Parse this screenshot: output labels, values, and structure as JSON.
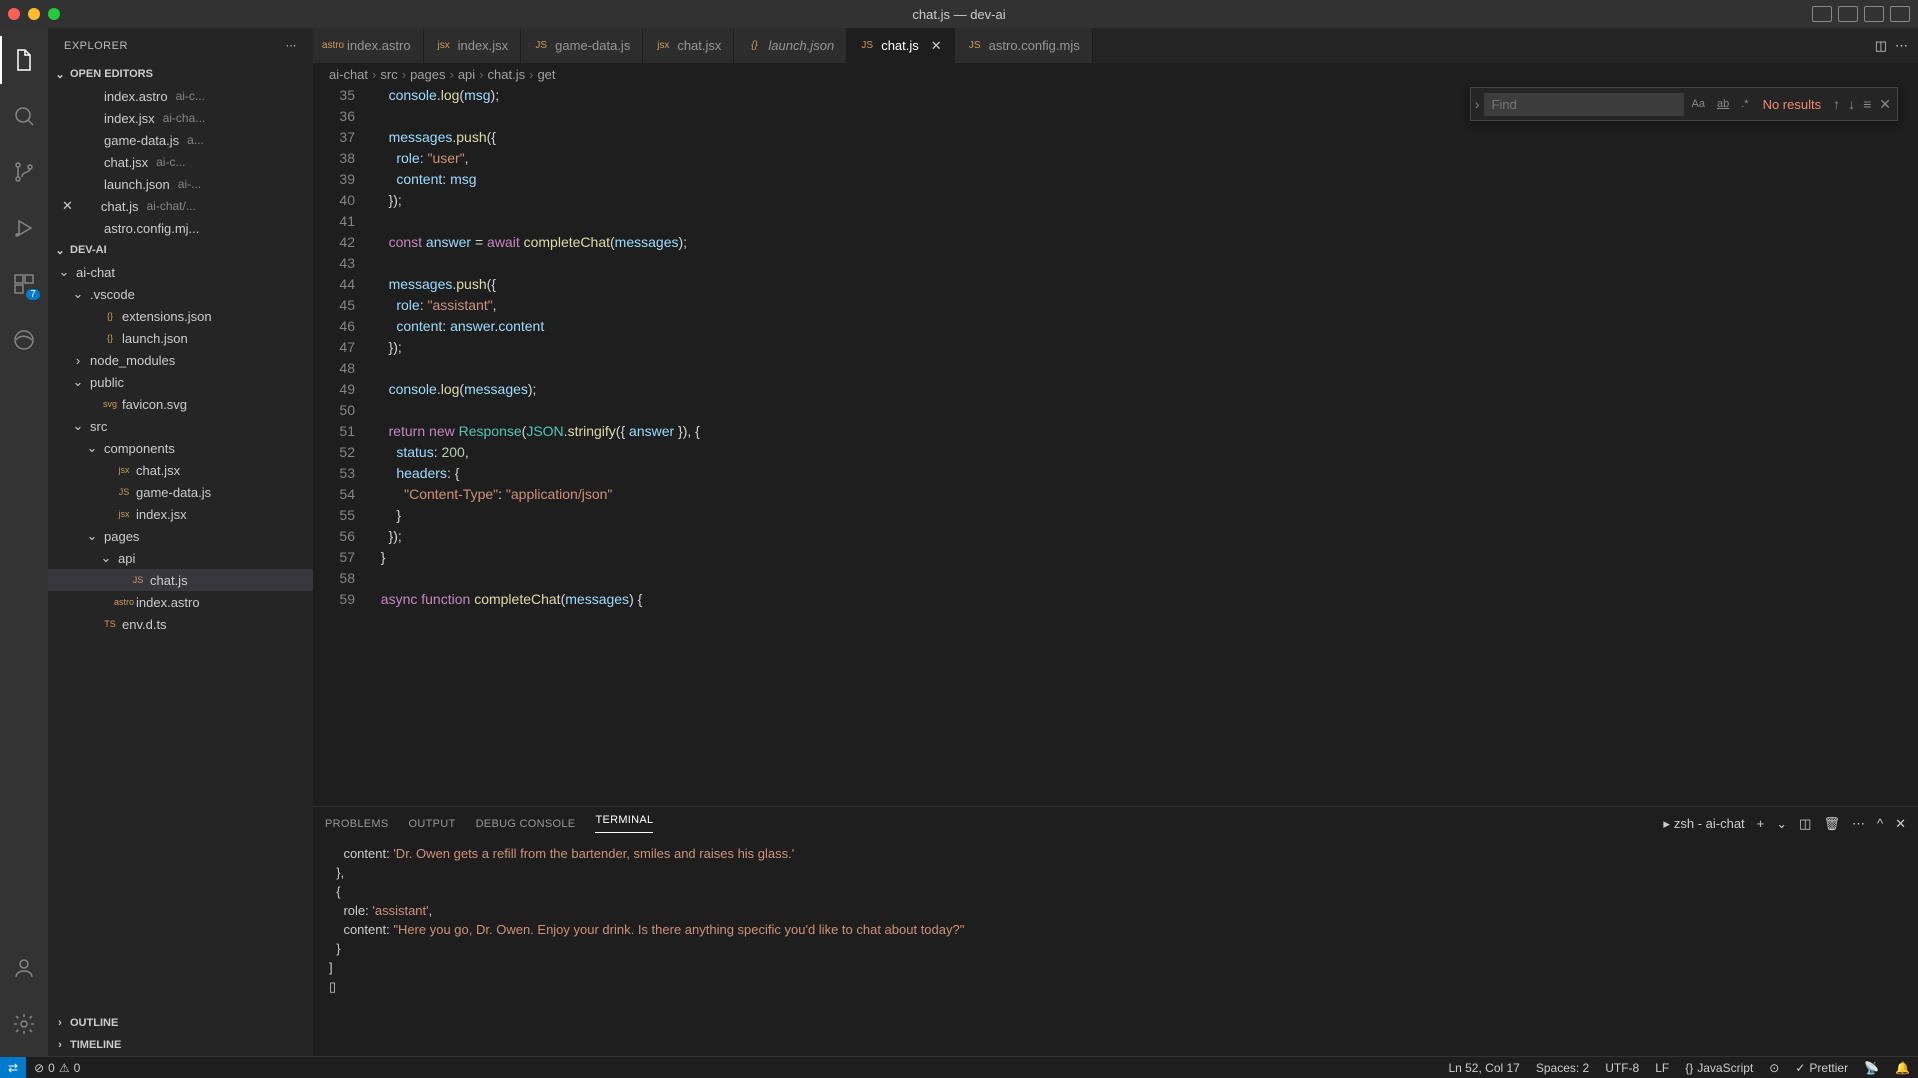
{
  "window": {
    "title": "chat.js — dev-ai"
  },
  "explorer": {
    "title": "EXPLORER"
  },
  "sections": {
    "open_editors": "OPEN EDITORS",
    "workspace": "DEV-AI",
    "outline": "OUTLINE",
    "timeline": "TIMELINE"
  },
  "open_editors": [
    {
      "name": "index.astro",
      "hint": "ai-c..."
    },
    {
      "name": "index.jsx",
      "hint": "ai-cha..."
    },
    {
      "name": "game-data.js",
      "hint": "a..."
    },
    {
      "name": "chat.jsx",
      "hint": "ai-c..."
    },
    {
      "name": "launch.json",
      "hint": "ai-..."
    },
    {
      "name": "chat.js",
      "hint": "ai-chat/...",
      "close": true
    },
    {
      "name": "astro.config.mj...",
      "hint": ""
    }
  ],
  "tree": {
    "root": "ai-chat",
    "folders_files": [
      {
        "type": "folder",
        "name": ".vscode",
        "depth": 1,
        "open": true
      },
      {
        "type": "file",
        "name": "extensions.json",
        "depth": 2,
        "icon": "{}"
      },
      {
        "type": "file",
        "name": "launch.json",
        "depth": 2,
        "icon": "{}"
      },
      {
        "type": "folder",
        "name": "node_modules",
        "depth": 1,
        "open": false
      },
      {
        "type": "folder",
        "name": "public",
        "depth": 1,
        "open": true
      },
      {
        "type": "file",
        "name": "favicon.svg",
        "depth": 2,
        "icon": "svg"
      },
      {
        "type": "folder",
        "name": "src",
        "depth": 1,
        "open": true
      },
      {
        "type": "folder",
        "name": "components",
        "depth": 2,
        "open": true
      },
      {
        "type": "file",
        "name": "chat.jsx",
        "depth": 3,
        "icon": "jsx"
      },
      {
        "type": "file",
        "name": "game-data.js",
        "depth": 3,
        "icon": "JS"
      },
      {
        "type": "file",
        "name": "index.jsx",
        "depth": 3,
        "icon": "jsx"
      },
      {
        "type": "folder",
        "name": "pages",
        "depth": 2,
        "open": true
      },
      {
        "type": "folder",
        "name": "api",
        "depth": 3,
        "open": true
      },
      {
        "type": "file",
        "name": "chat.js",
        "depth": 4,
        "icon": "JS",
        "selected": true
      },
      {
        "type": "file",
        "name": "index.astro",
        "depth": 3,
        "icon": "astro"
      },
      {
        "type": "file",
        "name": "env.d.ts",
        "depth": 2,
        "icon": "TS"
      }
    ]
  },
  "tabs": [
    {
      "label": "index.astro",
      "icon": "astro"
    },
    {
      "label": "index.jsx",
      "icon": "jsx"
    },
    {
      "label": "game-data.js",
      "icon": "JS"
    },
    {
      "label": "chat.jsx",
      "icon": "jsx"
    },
    {
      "label": "launch.json",
      "icon": "{}",
      "italic": true
    },
    {
      "label": "chat.js",
      "icon": "JS",
      "active": true
    },
    {
      "label": "astro.config.mjs",
      "icon": "JS"
    }
  ],
  "breadcrumbs": [
    "ai-chat",
    "src",
    "pages",
    "api",
    "chat.js",
    "get"
  ],
  "find": {
    "placeholder": "Find",
    "result": "No results"
  },
  "code_lines": [
    {
      "n": 35,
      "html": "    <span class='tok-var'>console</span>.<span class='tok-fn'>log</span>(<span class='tok-var'>msg</span>);"
    },
    {
      "n": 36,
      "html": ""
    },
    {
      "n": 37,
      "html": "    <span class='tok-var'>messages</span>.<span class='tok-fn'>push</span>({"
    },
    {
      "n": 38,
      "html": "      <span class='tok-prop'>role</span>: <span class='tok-str'>\"user\"</span>,"
    },
    {
      "n": 39,
      "html": "      <span class='tok-prop'>content</span>: <span class='tok-var'>msg</span>"
    },
    {
      "n": 40,
      "html": "    });"
    },
    {
      "n": 41,
      "html": ""
    },
    {
      "n": 42,
      "html": "    <span class='tok-kw'>const</span> <span class='tok-var'>answer</span> = <span class='tok-kw'>await</span> <span class='tok-fn'>completeChat</span>(<span class='tok-var'>messages</span>);"
    },
    {
      "n": 43,
      "html": ""
    },
    {
      "n": 44,
      "html": "    <span class='tok-var'>messages</span>.<span class='tok-fn'>push</span>({"
    },
    {
      "n": 45,
      "html": "      <span class='tok-prop'>role</span>: <span class='tok-str'>\"assistant\"</span>,"
    },
    {
      "n": 46,
      "html": "      <span class='tok-prop'>content</span>: <span class='tok-var'>answer</span>.<span class='tok-prop'>content</span>"
    },
    {
      "n": 47,
      "html": "    });"
    },
    {
      "n": 48,
      "html": ""
    },
    {
      "n": 49,
      "html": "    <span class='tok-var'>console</span>.<span class='tok-fn'>log</span>(<span class='tok-var'>messages</span>);"
    },
    {
      "n": 50,
      "html": ""
    },
    {
      "n": 51,
      "html": "    <span class='tok-kw'>return</span> <span class='tok-kw'>new</span> <span class='tok-cls'>Response</span>(<span class='tok-cls'>JSON</span>.<span class='tok-fn'>stringify</span>({ <span class='tok-var'>answer</span> }), {"
    },
    {
      "n": 52,
      "html": "      <span class='tok-prop'>status</span>: <span class='tok-num'>200</span>,"
    },
    {
      "n": 53,
      "html": "      <span class='tok-prop'>headers</span>: {"
    },
    {
      "n": 54,
      "html": "        <span class='tok-str'>\"Content-Type\"</span>: <span class='tok-str'>\"application/json\"</span>"
    },
    {
      "n": 55,
      "html": "      }"
    },
    {
      "n": 56,
      "html": "    });"
    },
    {
      "n": 57,
      "html": "  }"
    },
    {
      "n": 58,
      "html": ""
    },
    {
      "n": 59,
      "html": "  <span class='tok-kw'>async</span> <span class='tok-kw'>function</span> <span class='tok-fn'>completeChat</span>(<span class='tok-var'>messages</span>) {"
    }
  ],
  "panel_tabs": {
    "problems": "PROBLEMS",
    "output": "OUTPUT",
    "debug": "DEBUG CONSOLE",
    "terminal": "TERMINAL"
  },
  "terminal_label": "zsh - ai-chat",
  "terminal_lines": [
    "    content: <span class='tok-str'>'Dr. Owen gets a refill from the bartender, smiles and raises his glass.'</span>",
    "  },",
    "  {",
    "    role: <span class='tok-str'>'assistant'</span>,",
    "    content: <span class='tok-str'>\"Here you go, Dr. Owen. Enjoy your drink. Is there anything specific you'd like to chat about today?\"</span>",
    "  }",
    "]",
    "▯"
  ],
  "status": {
    "errors": "0",
    "warnings": "0",
    "position": "Ln 52, Col 17",
    "spaces": "Spaces: 2",
    "encoding": "UTF-8",
    "eol": "LF",
    "lang": "JavaScript",
    "prettier": "Prettier"
  },
  "extensions_badge": "7"
}
